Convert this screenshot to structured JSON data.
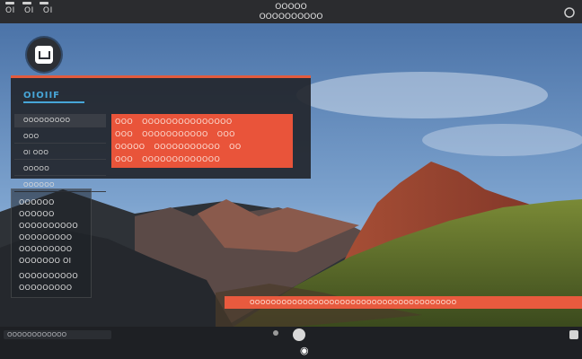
{
  "topbar": {
    "left_labels": [
      "OI",
      "OI",
      "OI"
    ],
    "title_line1": "OOOOO",
    "title_line2": "OOOOOOOOOO"
  },
  "panel_top": {
    "title": "OIOIIF",
    "side_items": [
      "OOOOOOOOO",
      "OOO",
      "OI  OOO",
      "OOOOO",
      "OOOOOO"
    ],
    "red_rows": [
      [
        "OOO",
        "OOOOOOOOOOOOOOO"
      ],
      [
        "OOO",
        "OOOOOOOOOOO",
        "OOO"
      ],
      [
        "OOOOO",
        "OOOOOOOOOOO",
        "OO"
      ],
      [
        "OOO",
        "OOOOOOOOOOOOO"
      ]
    ]
  },
  "panel_low": {
    "lines": [
      "OOOOOO",
      "OOOOOO",
      "OOOOOOOOOO",
      "OOOOOOOOO",
      "OOOOOOOOO",
      "OOOOOOO  OI",
      "OOOOOOOOOO",
      "OOOOOOOOO"
    ]
  },
  "red_bar": {
    "text": "OOOOOOOOOOOOOOOOOOOOOOOOOOOOOOOOOOOOOOO"
  },
  "footer": {
    "left_text": "OOOOOOOOOOOO"
  },
  "colors": {
    "accent": "#e9543a",
    "title_blue": "#47a6d8"
  },
  "icons": [
    "app-icon",
    "close-icon",
    "home-icon",
    "settings-icon"
  ]
}
